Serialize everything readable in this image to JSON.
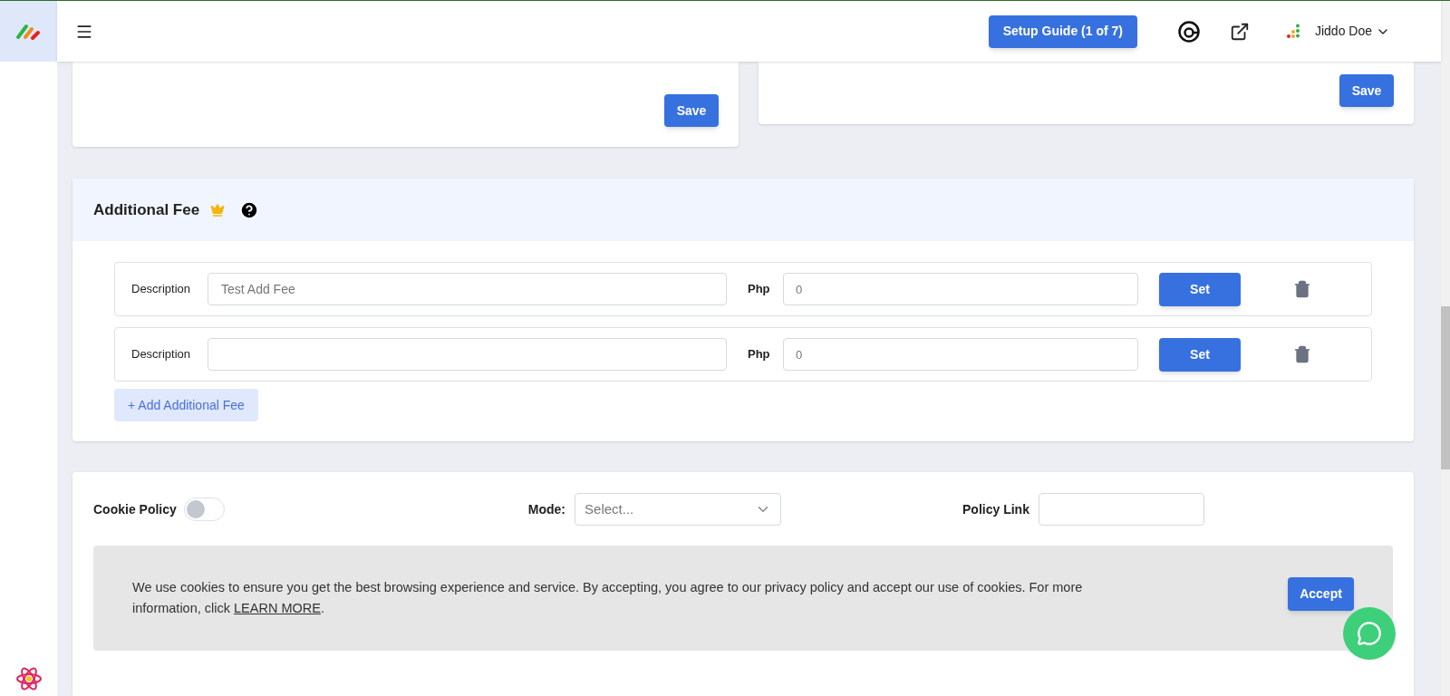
{
  "header": {
    "setup_guide": "Setup Guide (1 of 7)",
    "user_name": "Jiddo Doe"
  },
  "top_cards": [
    {
      "save": "Save"
    },
    {
      "save": "Save"
    }
  ],
  "additional_fee": {
    "title": "Additional Fee",
    "rows": [
      {
        "description_label": "Description",
        "description_value": "Test Add Fee",
        "currency_label": "Php",
        "amount_value": "0",
        "set": "Set"
      },
      {
        "description_label": "Description",
        "description_value": "",
        "currency_label": "Php",
        "amount_value": "0",
        "set": "Set"
      }
    ],
    "add_button": "+ Add Additional Fee"
  },
  "cookie": {
    "label": "Cookie Policy",
    "on": false,
    "mode_label": "Mode:",
    "mode_placeholder": "Select...",
    "policy_link_label": "Policy Link",
    "banner_text": "We use cookies to ensure you get the best browsing experience and service. By accepting, you agree to our privacy policy and accept our use of cookies. For more information, click ",
    "learn_more": "LEARN MORE",
    "banner_end": ".",
    "accept": "Accept"
  }
}
